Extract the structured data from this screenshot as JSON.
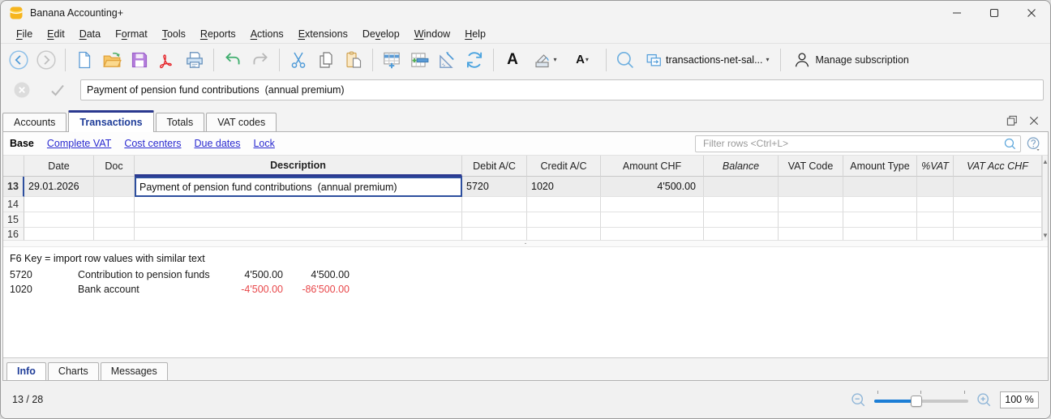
{
  "window": {
    "title": "Banana Accounting+"
  },
  "menu": {
    "items": [
      {
        "pre": "",
        "key": "F",
        "post": "ile"
      },
      {
        "pre": "",
        "key": "E",
        "post": "dit"
      },
      {
        "pre": "",
        "key": "D",
        "post": "ata"
      },
      {
        "pre": "F",
        "key": "o",
        "post": "rmat"
      },
      {
        "pre": "",
        "key": "T",
        "post": "ools"
      },
      {
        "pre": "",
        "key": "R",
        "post": "eports"
      },
      {
        "pre": "",
        "key": "A",
        "post": "ctions"
      },
      {
        "pre": "",
        "key": "E",
        "post": "xtensions"
      },
      {
        "pre": "De",
        "key": "v",
        "post": "elop"
      },
      {
        "pre": "",
        "key": "W",
        "post": "indow"
      },
      {
        "pre": "",
        "key": "H",
        "post": "elp"
      }
    ]
  },
  "toolbar": {
    "icons": [
      "back",
      "forward",
      "new-file",
      "open-file",
      "save",
      "pdf-export",
      "print",
      "undo",
      "redo",
      "cut",
      "copy",
      "paste",
      "add-rows",
      "insert-copied-rows",
      "page-setup",
      "recalculate",
      "font",
      "background-color",
      "text-color",
      "search",
      "file-switcher",
      "account"
    ],
    "file_dropdown_label": "transactions-net-sal...",
    "manage_subscription_label": "Manage subscription"
  },
  "edit_bar": {
    "value": "Payment of pension fund contributions  (annual premium)"
  },
  "tabs": {
    "items": [
      "Accounts",
      "Transactions",
      "Totals",
      "VAT codes"
    ],
    "active": "Transactions"
  },
  "view_bar": {
    "active": "Base",
    "links": [
      "Complete VAT",
      "Cost centers",
      "Due dates",
      "Lock"
    ]
  },
  "filter": {
    "placeholder": "Filter rows <Ctrl+L>"
  },
  "table": {
    "columns": [
      "",
      "Date",
      "Doc",
      "Description",
      "Debit A/C",
      "Credit A/C",
      "Amount CHF",
      "Balance",
      "VAT Code",
      "Amount Type",
      "%VAT",
      "VAT Acc CHF"
    ],
    "rows": [
      {
        "num": "13",
        "date": "29.01.2026",
        "doc": "",
        "description": "Payment of pension fund contributions  (annual premium)",
        "debit": "5720",
        "credit": "1020",
        "amount": "4'500.00",
        "balance": "",
        "vat_code": "",
        "amount_type": "",
        "pct_vat": "",
        "vat_acc": ""
      },
      {
        "num": "14",
        "date": "",
        "doc": "",
        "description": "",
        "debit": "",
        "credit": "",
        "amount": "",
        "balance": "",
        "vat_code": "",
        "amount_type": "",
        "pct_vat": "",
        "vat_acc": ""
      },
      {
        "num": "15",
        "date": "",
        "doc": "",
        "description": "",
        "debit": "",
        "credit": "",
        "amount": "",
        "balance": "",
        "vat_code": "",
        "amount_type": "",
        "pct_vat": "",
        "vat_acc": ""
      },
      {
        "num": "16",
        "date": "",
        "doc": "",
        "description": "",
        "debit": "",
        "credit": "",
        "amount": "",
        "balance": "",
        "vat_code": "",
        "amount_type": "",
        "pct_vat": "",
        "vat_acc": ""
      }
    ]
  },
  "info_panel": {
    "hint": "F6 Key = import row values with similar text",
    "accounts": [
      {
        "account": "5720",
        "name": "Contribution to pension funds",
        "amount": "4'500.00",
        "balance": "4'500.00"
      },
      {
        "account": "1020",
        "name": "Bank account",
        "amount": "-4'500.00",
        "balance": "-86'500.00"
      }
    ]
  },
  "bottom_tabs": {
    "items": [
      "Info",
      "Charts",
      "Messages"
    ],
    "active": "Info"
  },
  "status_bar": {
    "position": "13 / 28",
    "zoom": "100 %"
  },
  "colors": {
    "tab_accent": "#2b3990",
    "link_blue": "#2a2ad0",
    "negative_red": "#e8474a",
    "active_cell_border": "#2e4f9e",
    "icon_blue": "#4f9bd8",
    "slider_blue": "#1c7ed6",
    "folder_orange": "#f2b33d",
    "save_purple": "#b57edc",
    "pdf_red": "#e5252a",
    "undo_green": "#3fae6e"
  }
}
